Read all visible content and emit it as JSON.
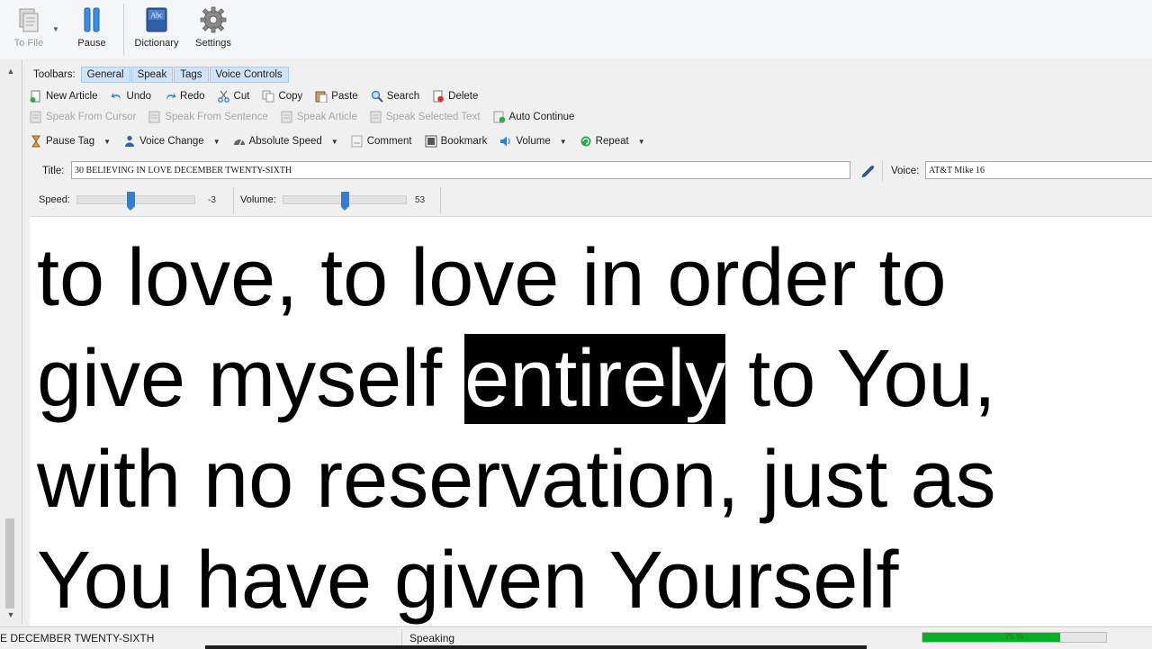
{
  "ribbon": {
    "to_file_label": "To File",
    "pause_label": "Pause",
    "dictionary_label": "Dictionary",
    "settings_label": "Settings",
    "dictionary_icon_text": "Abc"
  },
  "toolbars": {
    "label": "Toolbars:",
    "tabs": [
      "General",
      "Speak",
      "Tags",
      "Voice Controls"
    ]
  },
  "general_row": [
    "New Article",
    "Undo",
    "Redo",
    "Cut",
    "Copy",
    "Paste",
    "Search",
    "Delete"
  ],
  "speak_row": {
    "speak_from_cursor": "Speak From Cursor",
    "speak_from_sentence": "Speak From Sentence",
    "speak_article": "Speak Article",
    "speak_selected_text": "Speak Selected Text",
    "auto_continue": "Auto Continue"
  },
  "tags_row": {
    "pause_tag": "Pause Tag",
    "voice_change": "Voice Change",
    "absolute_speed": "Absolute Speed",
    "comment": "Comment",
    "bookmark": "Bookmark",
    "volume": "Volume",
    "repeat": "Repeat"
  },
  "title": {
    "label": "Title:",
    "value": "30 BELIEVING IN LOVE DECEMBER TWENTY-SIXTH"
  },
  "voice": {
    "label": "Voice:",
    "value": "AT&T Mike 16"
  },
  "speed": {
    "label": "Speed:",
    "value": "-3",
    "level": 0.45
  },
  "volume": {
    "label": "Volume:",
    "value": "53",
    "level": 0.53
  },
  "reader": {
    "line1": "to love, to love in order to",
    "line2_before": "give myself ",
    "line2_highlight": "entirely",
    "line2_after": " to You,",
    "line3": "with no reservation, just as",
    "line4": "You have given Yourself"
  },
  "status": {
    "title": "E DECEMBER TWENTY-SIXTH",
    "state": "Speaking",
    "progress_label": "75 %",
    "progress": 0.75
  },
  "colors": {
    "accent": "#2f7ed8",
    "progress_fill": "#06b025",
    "highlight_bg": "#000000",
    "highlight_fg": "#ffffff"
  }
}
